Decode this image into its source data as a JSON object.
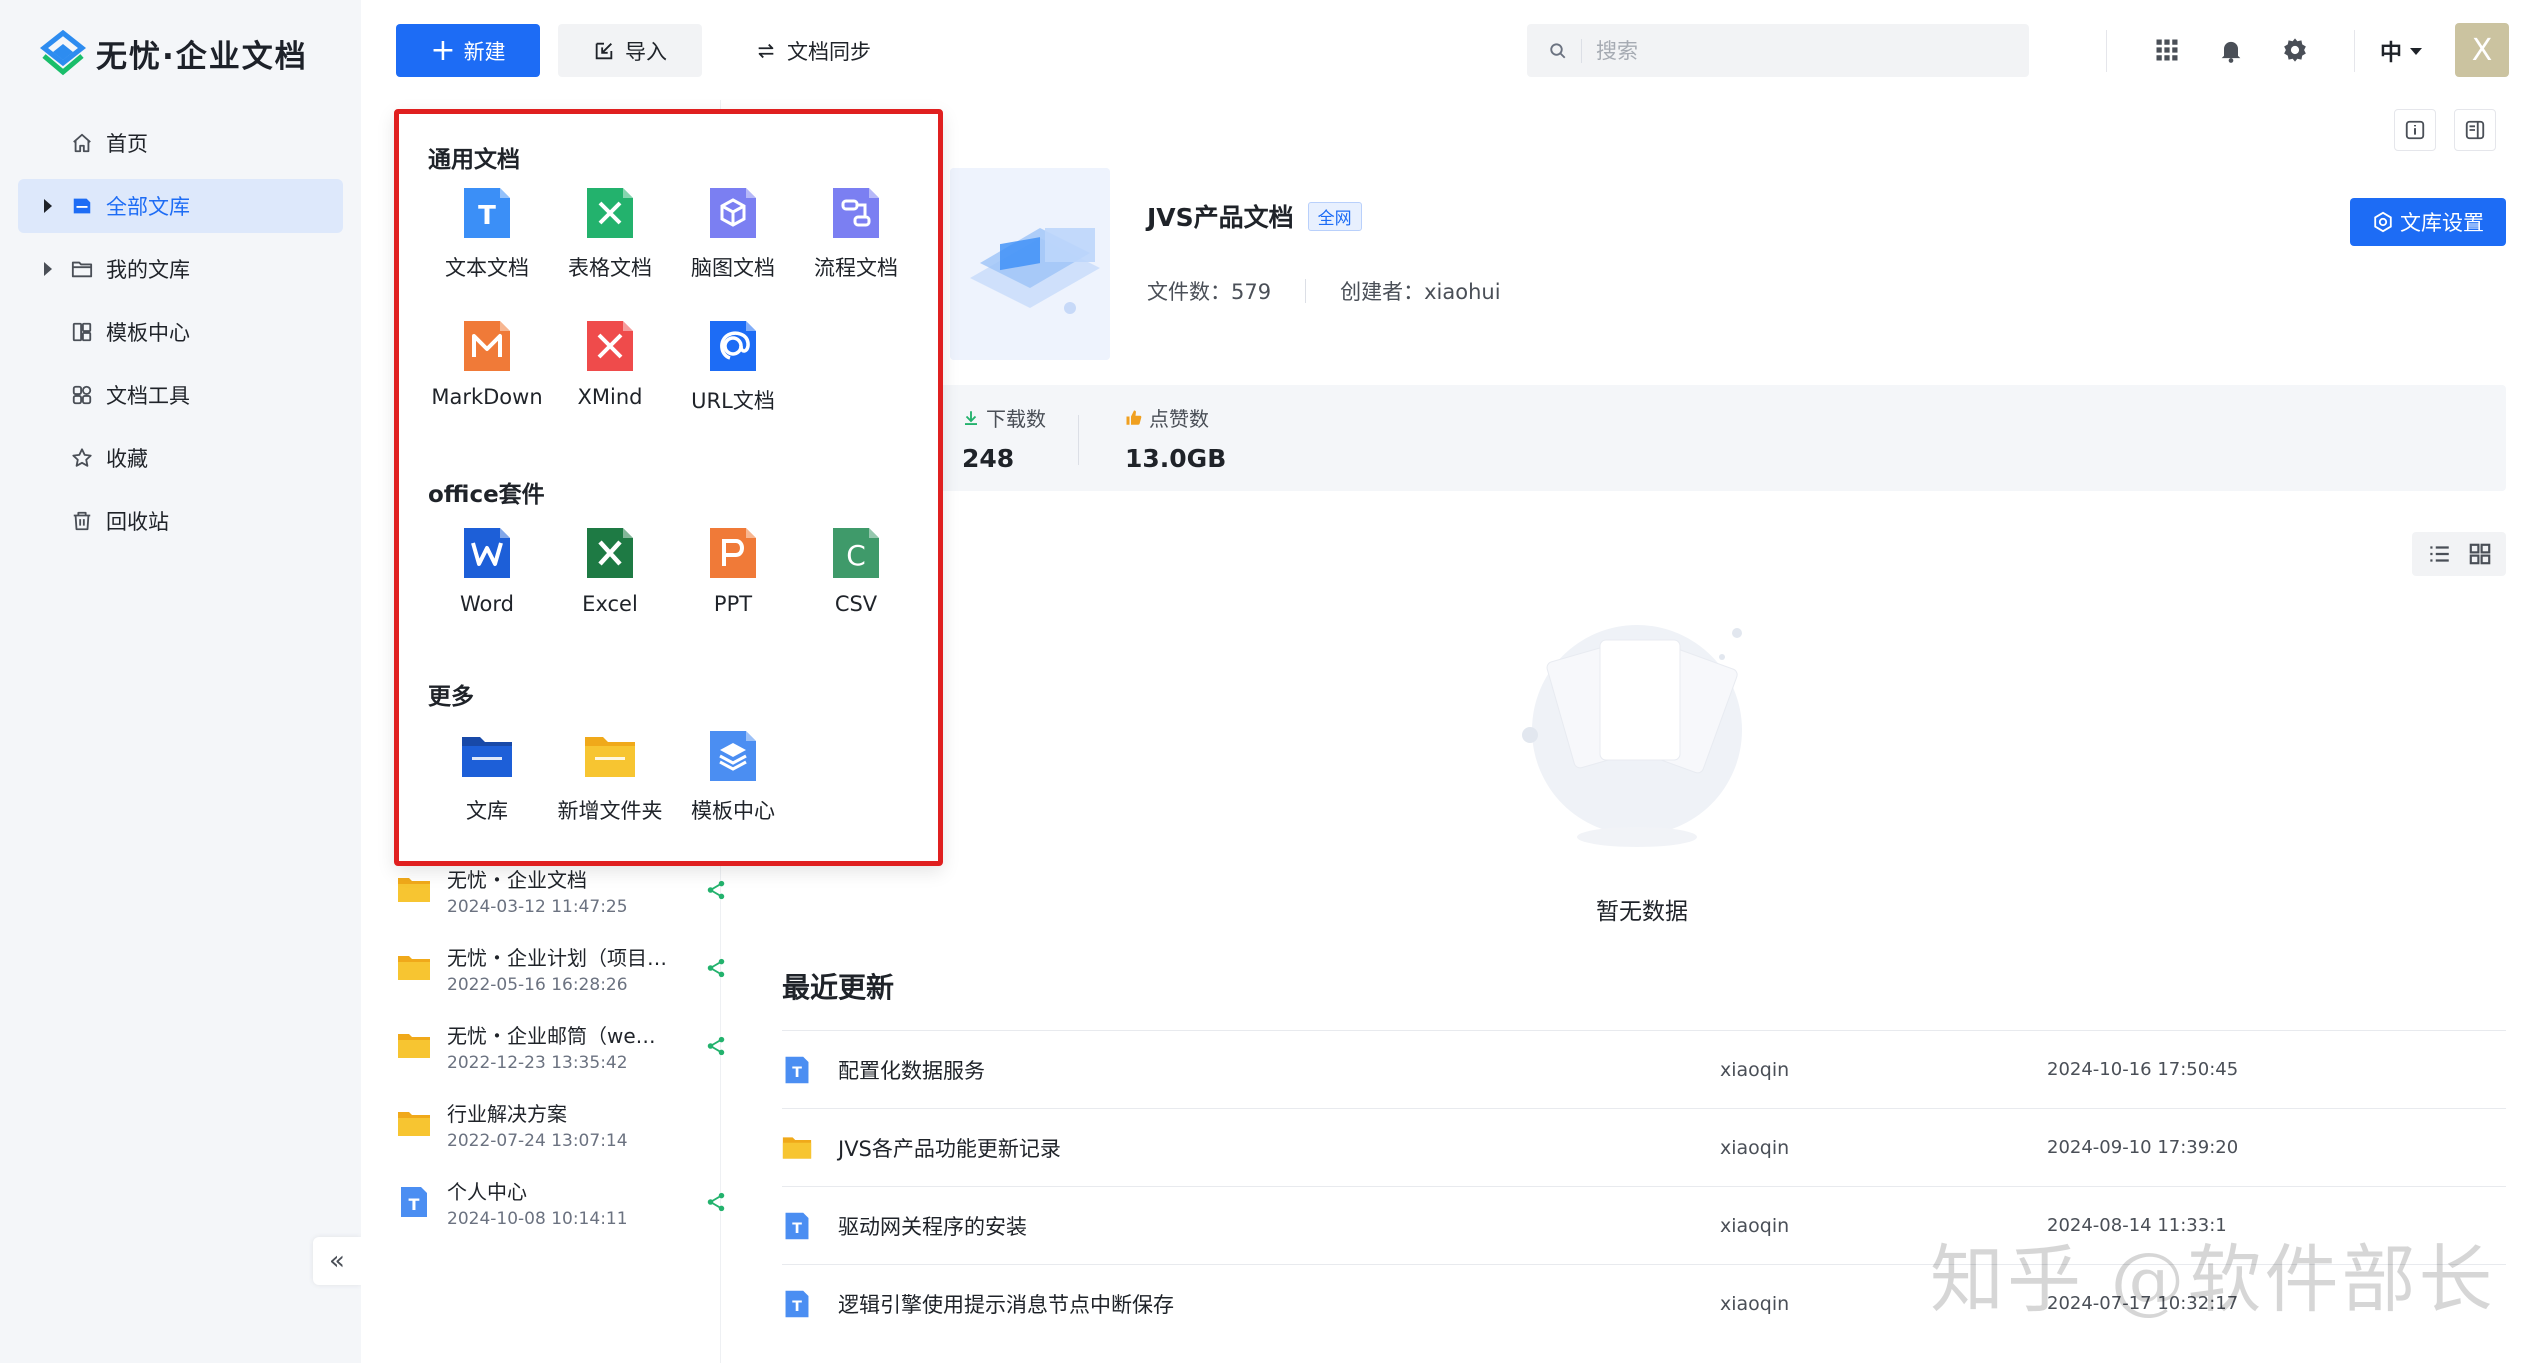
{
  "app": {
    "logo_text": "无忧·企业文档",
    "watermark": "知乎 @软件部长"
  },
  "sidebar": {
    "items": [
      {
        "label": "首页",
        "icon": "home-icon",
        "active": false,
        "expandable": false
      },
      {
        "label": "全部文库",
        "icon": "library-icon",
        "active": true,
        "expandable": true
      },
      {
        "label": "我的文库",
        "icon": "folder-icon",
        "active": false,
        "expandable": true
      },
      {
        "label": "模板中心",
        "icon": "template-icon",
        "active": false,
        "expandable": false
      },
      {
        "label": "文档工具",
        "icon": "tools-icon",
        "active": false,
        "expandable": false
      },
      {
        "label": "收藏",
        "icon": "star-icon",
        "active": false,
        "expandable": false
      },
      {
        "label": "回收站",
        "icon": "trash-icon",
        "active": false,
        "expandable": false
      }
    ],
    "collapse_label": "«"
  },
  "toolbar": {
    "new_label": "新建",
    "import_label": "导入",
    "sync_label": "文档同步",
    "search_placeholder": "搜索",
    "lang_label": "中",
    "avatar_letter": "X"
  },
  "new_menu": {
    "sections": [
      {
        "title": "通用文档",
        "items": [
          {
            "label": "文本文档",
            "icon": "text-doc-icon",
            "color": "#3b8ff7"
          },
          {
            "label": "表格文档",
            "icon": "sheet-doc-icon",
            "color": "#23b26d"
          },
          {
            "label": "脑图文档",
            "icon": "mindmap-doc-icon",
            "color": "#7b7ff2"
          },
          {
            "label": "流程文档",
            "icon": "flow-doc-icon",
            "color": "#7b7ff2"
          },
          {
            "label": "MarkDown",
            "icon": "markdown-icon",
            "color": "#f07a38"
          },
          {
            "label": "XMind",
            "icon": "xmind-icon",
            "color": "#ef4b4b"
          },
          {
            "label": "URL文档",
            "icon": "url-doc-icon",
            "color": "#1d6cf5"
          }
        ]
      },
      {
        "title": "office套件",
        "items": [
          {
            "label": "Word",
            "icon": "word-icon",
            "color": "#1d5fd8"
          },
          {
            "label": "Excel",
            "icon": "excel-icon",
            "color": "#1e7a44"
          },
          {
            "label": "PPT",
            "icon": "ppt-icon",
            "color": "#f07a38"
          },
          {
            "label": "CSV",
            "icon": "csv-icon",
            "color": "#3f9a6a"
          }
        ]
      },
      {
        "title": "更多",
        "items": [
          {
            "label": "文库",
            "icon": "library-folder-icon",
            "color": "#1d5fd8"
          },
          {
            "label": "新增文件夹",
            "icon": "new-folder-icon",
            "color": "#f7c531"
          },
          {
            "label": "模板中心",
            "icon": "template-center-icon",
            "color": "#4b8ef2"
          }
        ]
      }
    ]
  },
  "file_list": [
    {
      "name": "无忧・企业文档",
      "date": "2024-03-12 11:47:25",
      "type": "folder",
      "shared": true
    },
    {
      "name": "无忧・企业计划（项目管理）",
      "date": "2022-05-16 16:28:26",
      "type": "folder",
      "shared": true
    },
    {
      "name": "无忧・企业邮筒（webmail）",
      "date": "2022-12-23 13:35:42",
      "type": "folder",
      "shared": true
    },
    {
      "name": "行业解决方案",
      "date": "2022-07-24 13:07:14",
      "type": "folder",
      "shared": false
    },
    {
      "name": "个人中心",
      "date": "2024-10-08 10:14:11",
      "type": "text",
      "shared": true
    }
  ],
  "library": {
    "title": "JVS产品文档",
    "badge": "全网",
    "file_count_label": "文件数：579",
    "creator_label": "创建者：xiaohui",
    "settings_label": "文库设置",
    "stats": [
      {
        "label": "下载数",
        "value": "248",
        "icon": "download-icon",
        "color": "#23b26d"
      },
      {
        "label": "点赞数",
        "value": "13.0GB",
        "icon": "thumb-up-icon",
        "color": "#f0a020"
      }
    ]
  },
  "empty": {
    "text": "暂无数据"
  },
  "recent": {
    "title": "最近更新",
    "rows": [
      {
        "name": "配置化数据服务",
        "user": "xiaoqin",
        "time": "2024-10-16 17:50:45",
        "type": "text"
      },
      {
        "name": "JVS各产品功能更新记录",
        "user": "xiaoqin",
        "time": "2024-09-10 17:39:20",
        "type": "folder"
      },
      {
        "name": "驱动网关程序的安装",
        "user": "xiaoqin",
        "time": "2024-08-14 11:33:1",
        "type": "text"
      },
      {
        "name": "逻辑引擎使用提示消息节点中断保存",
        "user": "xiaoqin",
        "time": "2024-07-17 10:32:17",
        "type": "text"
      }
    ]
  },
  "colors": {
    "primary": "#1d6cf5",
    "highlight_border": "#e02020",
    "sidebar_bg": "#f4f6f9",
    "folder": "#f7c531"
  }
}
